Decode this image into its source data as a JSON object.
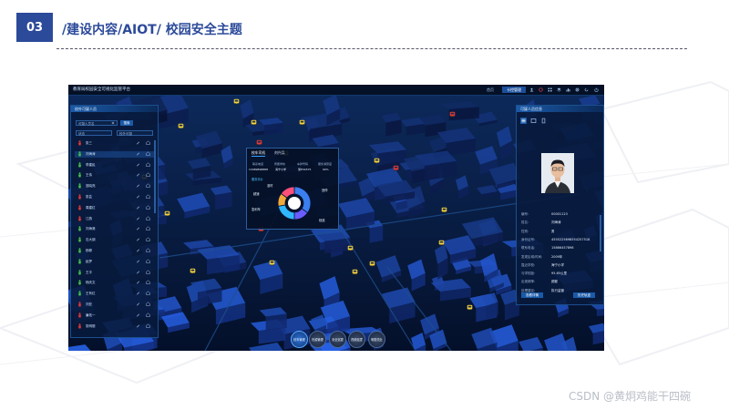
{
  "slide": {
    "number": "03",
    "title": "/建设内容/AIOT/ 校园安全主题"
  },
  "app": {
    "title": "教育局校园安全可视化监管平台",
    "tabs": [
      "首页",
      "卡控管理"
    ],
    "active_tab": "卡控管理"
  },
  "left_panel": {
    "title": "校外可疑人员",
    "search_placeholder": "可疑人员名",
    "search_button": "搜索",
    "filters": [
      "状态",
      "校外可疑"
    ],
    "rows": [
      {
        "name": "张三",
        "color": "#e53935"
      },
      {
        "name": "刘海涛",
        "color": "#43c24a",
        "selected": true
      },
      {
        "name": "李建民",
        "color": "#43c24a"
      },
      {
        "name": "王伟",
        "color": "#43c24a"
      },
      {
        "name": "邹晓亮",
        "color": "#43c24a"
      },
      {
        "name": "张芸",
        "color": "#e53935"
      },
      {
        "name": "周建红",
        "color": "#e53935"
      },
      {
        "name": "江燕",
        "color": "#e53935"
      },
      {
        "name": "刘海港",
        "color": "#43c24a"
      },
      {
        "name": "石大钢",
        "color": "#43c24a"
      },
      {
        "name": "杨柳",
        "color": "#43c24a"
      },
      {
        "name": "赵梦",
        "color": "#43c24a"
      },
      {
        "name": "王平",
        "color": "#43c24a"
      },
      {
        "name": "杨庆文",
        "color": "#43c24a"
      },
      {
        "name": "王有红",
        "color": "#43c24a"
      },
      {
        "name": "刘亚",
        "color": "#e53935"
      },
      {
        "name": "廉佑一",
        "color": "#e53935"
      },
      {
        "name": "张明丽",
        "color": "#e53935"
      }
    ]
  },
  "popup": {
    "tabs": [
      "校车司机",
      "刘兴兵"
    ],
    "headers": [
      "联系电话",
      "所属学校",
      "车牌号码",
      "服务满意度"
    ],
    "values": [
      "13989898888",
      "海宁小学",
      "浙E34575",
      "99%"
    ],
    "chart_title": "服务评价",
    "legend": [
      "准时",
      "超速",
      "急刹车",
      "违停",
      "绕道"
    ]
  },
  "chart_data": {
    "type": "pie",
    "title": "服务评价",
    "labels": [
      "准时",
      "违停",
      "绕道",
      "急刹车",
      "超速"
    ],
    "values": [
      35,
      15,
      22,
      13,
      15
    ],
    "colors": [
      "#3b7ef0",
      "#6a5cff",
      "#2fb8ff",
      "#f2a93b",
      "#ff4f7a"
    ]
  },
  "right_panel": {
    "title": "可疑人员信息",
    "fields": [
      {
        "label": "编号:",
        "value": "00001123"
      },
      {
        "label": "姓名:",
        "value": "刘海涛"
      },
      {
        "label": "性别:",
        "value": "男"
      },
      {
        "label": "身份证号:",
        "value": "4555225698554257518"
      },
      {
        "label": "联系电话:",
        "value": "15866457896"
      },
      {
        "label": "发现区域/时间:",
        "value": "2009年"
      },
      {
        "label": "靠近学校:",
        "value": "海宁小学"
      },
      {
        "label": "与学校距:",
        "value": "95.65公里"
      },
      {
        "label": "出现频率:",
        "value": "频繁"
      },
      {
        "label": "处理建议:",
        "value": "执行监管"
      }
    ],
    "buttons": [
      "查看详情",
      "历史轨迹"
    ]
  },
  "bottom_nav": [
    "校车管理",
    "热源管理",
    "安全巡更",
    "视频巡逻",
    "明厨亮灶"
  ],
  "watermark": "CSDN @黄炯鸡能干四碗"
}
